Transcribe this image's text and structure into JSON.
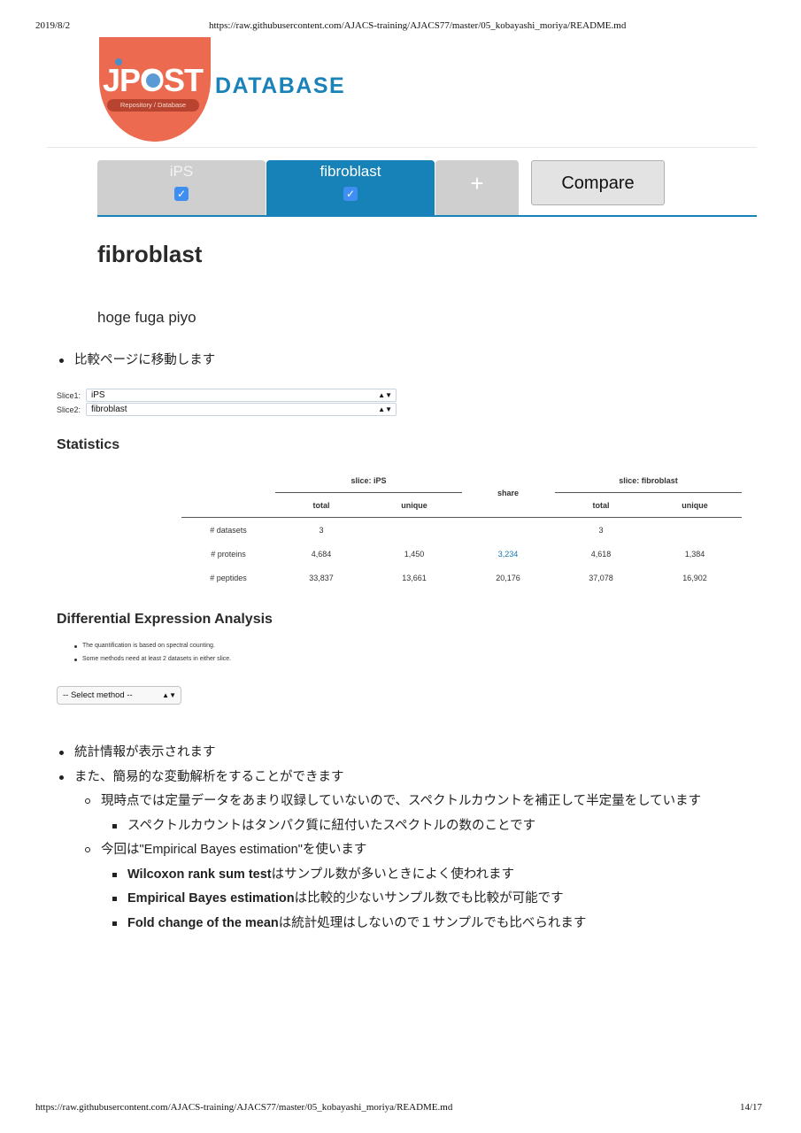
{
  "print_header": {
    "date": "2019/8/2",
    "url": "https://raw.githubusercontent.com/AJACS-training/AJACS77/master/05_kobayashi_moriya/README.md"
  },
  "print_footer": {
    "url": "https://raw.githubusercontent.com/AJACS-training/AJACS77/master/05_kobayashi_moriya/README.md",
    "page": "14/17"
  },
  "logo": {
    "word": "JPOST",
    "subtitle": "Repository / Database",
    "database_label": "DATABASE",
    "colors": {
      "circle": "#ec6a50",
      "database_text": "#1a82b8"
    }
  },
  "tabs": [
    {
      "label": "iPS",
      "checked": true,
      "active": false
    },
    {
      "label": "fibroblast",
      "checked": true,
      "active": true
    }
  ],
  "add_tab_label": "+",
  "compare_label": "Compare",
  "accent_color": "#1682b8",
  "page": {
    "title": "fibroblast",
    "description": "hoge fuga piyo"
  },
  "intro_bullets": [
    "比較ページに移動します"
  ],
  "slices": {
    "slice1_label": "Slice1:",
    "slice1_value": "iPS",
    "slice2_label": "Slice2:",
    "slice2_value": "fibroblast"
  },
  "statistics": {
    "heading": "Statistics",
    "group1": "slice: iPS",
    "group2": "slice: fibroblast",
    "share_header": "share",
    "sub_total": "total",
    "sub_unique": "unique",
    "rows": [
      {
        "label": "# datasets",
        "total1": "3",
        "unique1": "",
        "share": "",
        "total2": "3",
        "unique2": ""
      },
      {
        "label": "# proteins",
        "total1": "4,684",
        "unique1": "1,450",
        "share": "3,234",
        "total2": "4,618",
        "unique2": "1,384"
      },
      {
        "label": "# peptides",
        "total1": "33,837",
        "unique1": "13,661",
        "share": "20,176",
        "total2": "37,078",
        "unique2": "16,902"
      }
    ]
  },
  "dea": {
    "heading": "Differential Expression Analysis",
    "notes": [
      "The quantification is based on spectral counting.",
      "Some methods need at least 2 datasets in either slice."
    ],
    "select_placeholder": "-- Select method --"
  },
  "notes": {
    "item1": "統計情報が表示されます",
    "item2": "また、簡易的な変動解析をすることができます",
    "item2_sub1": "現時点では定量データをあまり収録していないので、スペクトルカウントを補正して半定量をしています",
    "item2_sub1_sub1": "スペクトルカウントはタンパク質に紐付いたスペクトルの数のことです",
    "item2_sub2": "今回は\"Empirical Bayes estimation\"を使います",
    "methods": [
      {
        "name": "Wilcoxon rank sum test",
        "desc": "はサンプル数が多いときによく使われます"
      },
      {
        "name": "Empirical Bayes estimation",
        "desc": "は比較的少ないサンプル数でも比較が可能です"
      },
      {
        "name": "Fold change of the mean",
        "desc": "は統計処理はしないので１サンプルでも比べられます"
      }
    ]
  }
}
